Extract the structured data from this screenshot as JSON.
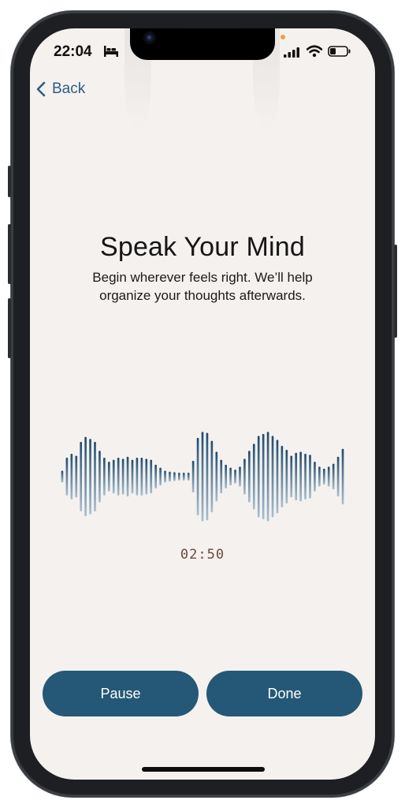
{
  "status_bar": {
    "time": "22:04",
    "icons": [
      "bed-icon",
      "signal-icon",
      "wifi-icon",
      "battery-icon"
    ],
    "battery_level": 0.35
  },
  "nav": {
    "back_label": "Back"
  },
  "main": {
    "title": "Speak Your Mind",
    "subtitle_line1": "Begin wherever feels right. We’ll help",
    "subtitle_line2": "organize your thoughts afterwards.",
    "waveform_levels": [
      0.12,
      0.38,
      0.46,
      0.42,
      0.7,
      0.8,
      0.76,
      0.7,
      0.52,
      0.38,
      0.3,
      0.34,
      0.38,
      0.36,
      0.4,
      0.34,
      0.38,
      0.38,
      0.36,
      0.34,
      0.24,
      0.18,
      0.12,
      0.1,
      0.09,
      0.08,
      0.08,
      0.08,
      0.32,
      0.78,
      0.9,
      0.88,
      0.72,
      0.5,
      0.34,
      0.24,
      0.18,
      0.14,
      0.2,
      0.36,
      0.52,
      0.66,
      0.82,
      0.86,
      0.9,
      0.82,
      0.74,
      0.62,
      0.54,
      0.42,
      0.48,
      0.5,
      0.46,
      0.44,
      0.3,
      0.2,
      0.16,
      0.2,
      0.26,
      0.4,
      0.56
    ],
    "timer": "02:50"
  },
  "actions": {
    "pause_label": "Pause",
    "done_label": "Done"
  },
  "colors": {
    "background": "#f5f1ef",
    "accent": "#245876",
    "link": "#2b5d85",
    "waveform_top": "#1f4c6e",
    "waveform_bottom": "#a7bfce",
    "timer": "#6a4a3e"
  }
}
